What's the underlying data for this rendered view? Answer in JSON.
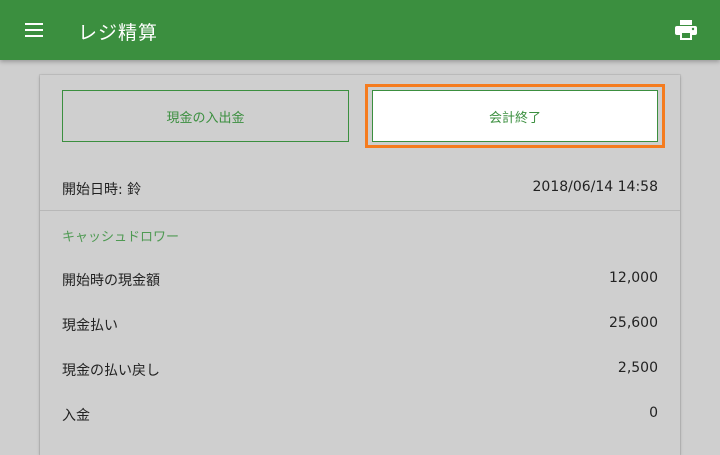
{
  "app_bar": {
    "title": "レジ精算",
    "menu_icon": "menu-icon",
    "print_icon": "print-icon",
    "color": "#3b8f3f"
  },
  "actions": {
    "cash_in_out_label": "現金の入出金",
    "close_account_label": "会計終了",
    "highlight_color": "#f57c1f"
  },
  "session": {
    "start_label": "開始日時: 鈴",
    "start_value": "2018/06/14 14:58"
  },
  "cash_flow": {
    "section_title": "キャッシュドロワー",
    "rows": [
      {
        "label": "開始時の現金額",
        "value": "12,000"
      },
      {
        "label": "現金払い",
        "value": "25,600"
      },
      {
        "label": "現金の払い戻し",
        "value": "2,500"
      },
      {
        "label": "入金",
        "value": "0"
      }
    ]
  }
}
